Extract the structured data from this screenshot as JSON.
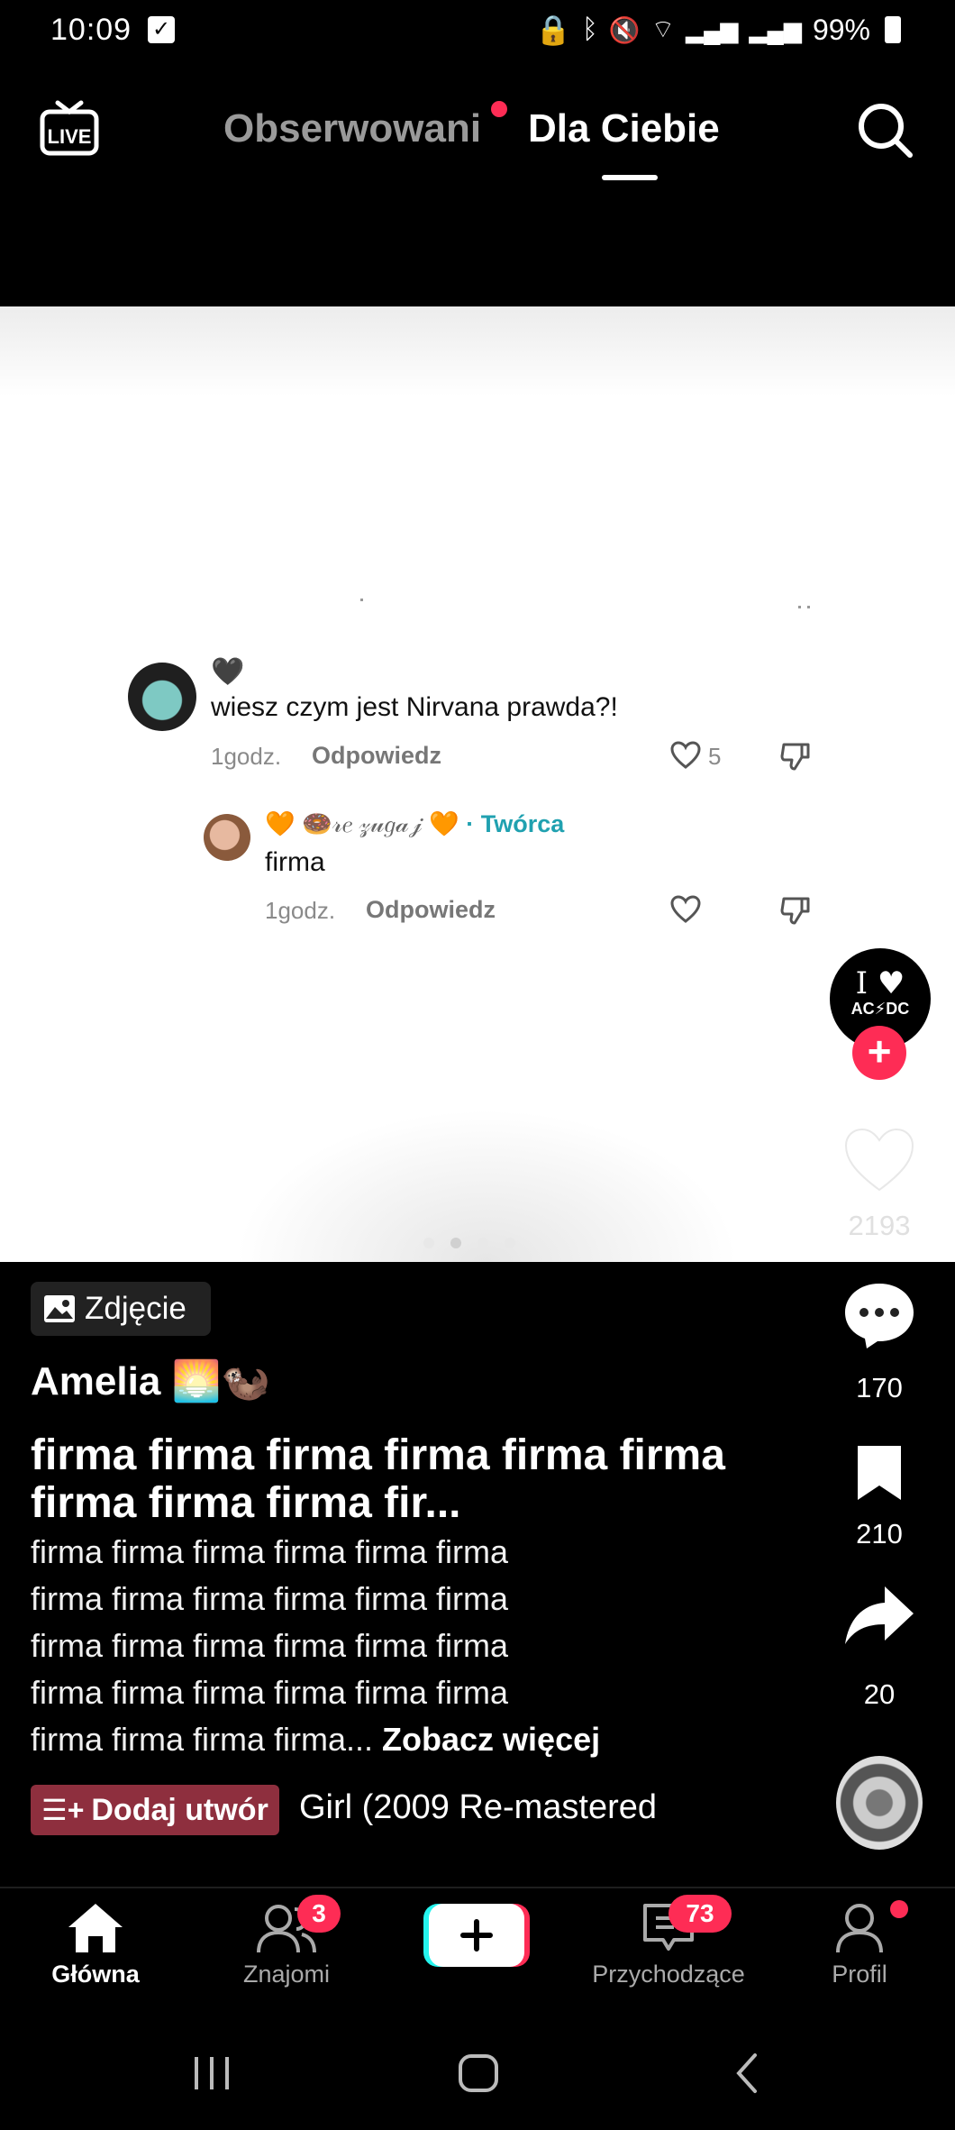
{
  "status_bar": {
    "time": "10:09",
    "battery": "99%",
    "icons": [
      "notification-check-icon",
      "lock-app-icon",
      "bluetooth-icon",
      "mute-icon",
      "wifi-icon",
      "signal-icon",
      "signal-icon",
      "battery-icon"
    ]
  },
  "top_nav": {
    "live_label": "LIVE",
    "tabs": [
      {
        "label": "Obserwowani",
        "active": false,
        "has_dot": true
      },
      {
        "label": "Dla Ciebie",
        "active": true
      }
    ]
  },
  "photo": {
    "comments": [
      {
        "user_emoji": "🖤",
        "text": "wiesz czym jest Nirvana prawda?!",
        "time": "1godz.",
        "reply_label": "Odpowiedz",
        "likes": "5"
      },
      {
        "user_name": "🧡 🍩𝓇𝑒 𝓏𝓊𝑔𝒶𝒿 🧡",
        "creator_label": "· Twórca",
        "text": "firma",
        "time": "1godz.",
        "reply_label": "Odpowiedz"
      }
    ],
    "carousel_pages": 4,
    "carousel_active": 2
  },
  "rail": {
    "avatar_text_1": "I ♥",
    "avatar_text_2": "AC⚡DC",
    "likes": "2193",
    "comments": "170",
    "saves": "210",
    "shares": "20"
  },
  "post": {
    "type_label": "Zdjęcie",
    "author": "Amelia 🌅🦦",
    "title": "firma firma firma firma firma firma firma firma firma fir...",
    "description_lines": [
      "firma firma firma firma firma firma",
      "firma firma firma firma firma firma",
      "firma firma firma firma firma firma",
      "firma firma firma firma firma firma",
      "firma firma firma firma..."
    ],
    "see_more": "Zobacz więcej",
    "add_song_label": "Dodaj utwór",
    "song": "Girl (2009 Re-mastered"
  },
  "bottom_nav": {
    "home": "Główna",
    "friends": "Znajomi",
    "friends_badge": "3",
    "inbox": "Przychodzące",
    "inbox_badge": "73",
    "profile": "Profil"
  },
  "colors": {
    "accent": "#fe2c55",
    "creator": "#20a1b0",
    "add_song_bg": "#8e2f3e"
  }
}
